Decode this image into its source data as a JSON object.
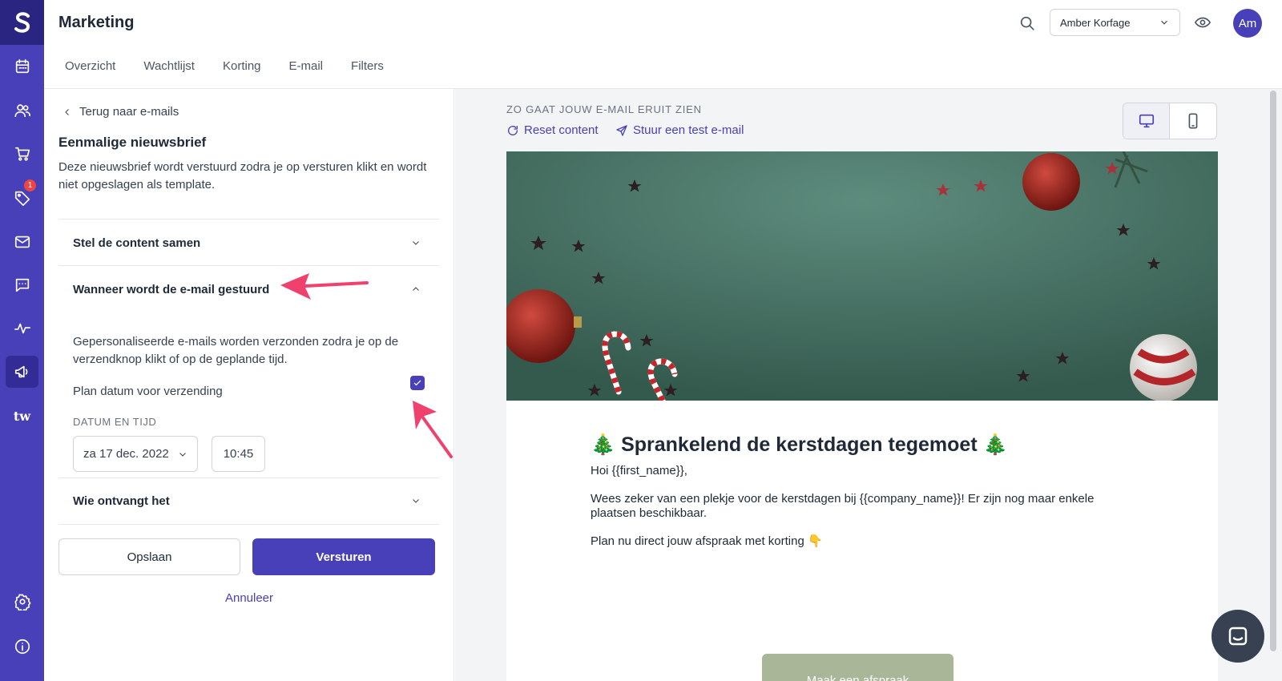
{
  "sidebar": {
    "logo_letter": "S",
    "items": [
      {
        "name": "calendar-icon"
      },
      {
        "name": "users-icon"
      },
      {
        "name": "cart-icon"
      },
      {
        "name": "tag-icon",
        "badge": "1"
      },
      {
        "name": "mail-icon"
      },
      {
        "name": "chat-icon"
      },
      {
        "name": "activity-icon"
      },
      {
        "name": "megaphone-icon",
        "active": true
      },
      {
        "name": "tw-logo",
        "label": "tw"
      },
      {
        "name": "gear-icon"
      },
      {
        "name": "info-icon"
      }
    ]
  },
  "header": {
    "title": "Marketing",
    "tabs": [
      "Overzicht",
      "Wachtlijst",
      "Korting",
      "E-mail",
      "Filters"
    ],
    "user_select": "Amber Korfage",
    "avatar_initials": "Am"
  },
  "left_panel": {
    "back_label": "Terug naar e-mails",
    "title": "Eenmalige nieuwsbrief",
    "description": "Deze nieuwsbrief wordt verstuurd zodra je op versturen klikt en wordt niet opgeslagen als template.",
    "sections": [
      {
        "label": "Stel de content samen",
        "expanded": false
      },
      {
        "label": "Wanneer wordt de e-mail gestuurd",
        "expanded": true
      },
      {
        "label": "Wie ontvangt het",
        "expanded": false
      }
    ],
    "when_body": "Gepersonaliseerde e-mails worden verzonden zodra je op de verzendknop klikt of op de geplande tijd.",
    "schedule_label": "Plan datum voor verzending",
    "schedule_checked": true,
    "datetime_label": "DATUM EN TIJD",
    "date_value": "za 17 dec. 2022",
    "time_value": "10:45",
    "save_label": "Opslaan",
    "send_label": "Versturen",
    "cancel_label": "Annuleer"
  },
  "preview": {
    "label": "ZO GAAT JOUW E-MAIL ERUIT ZIEN",
    "reset_label": "Reset content",
    "test_label": "Stuur een test e-mail",
    "device_selected": "desktop",
    "email": {
      "title": "🎄 Sprankelend de kerstdagen tegemoet 🎄",
      "greeting": "Hoi {{first_name}},",
      "body": "Wees zeker van een plekje voor de kerstdagen bij {{company_name}}! Er zijn nog maar enkele plaatsen beschikbaar.",
      "cta_text": "Plan nu direct jouw afspraak met korting 👇",
      "button_label": "Maak een afspraak"
    }
  },
  "colors": {
    "brand": "#4840b8",
    "sidebar_dark": "#2a2580",
    "annotation_arrow": "#f0406e",
    "email_button": "#a9b698",
    "hero_green": "#3f6b5d"
  }
}
